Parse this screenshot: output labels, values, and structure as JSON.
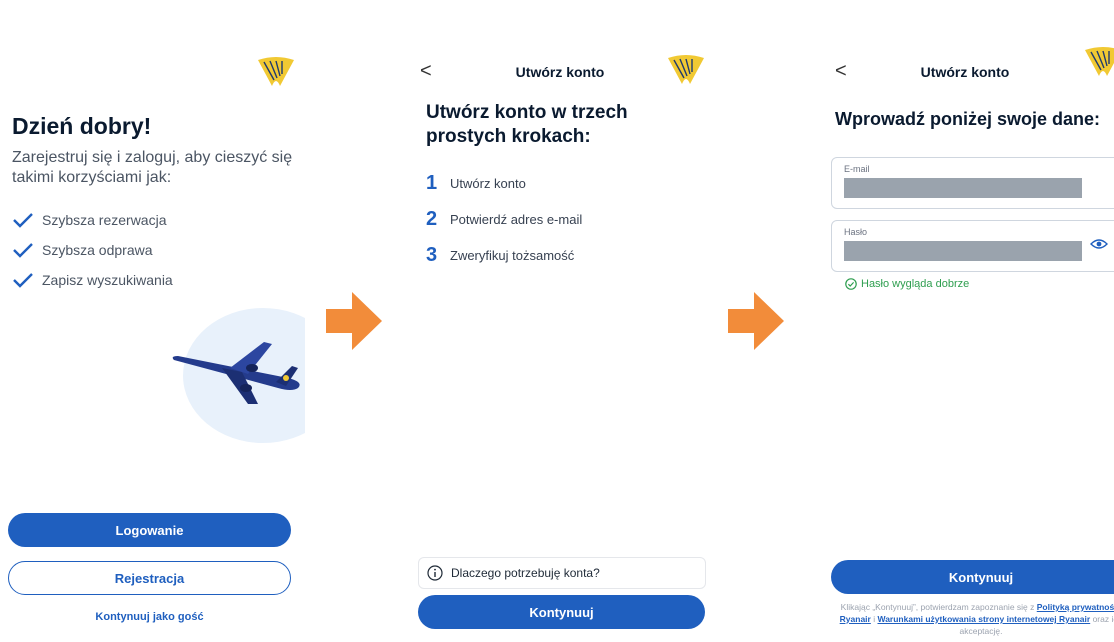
{
  "colors": {
    "primary": "#1f5fbf",
    "arrow": "#f28c3a",
    "logo": "#f1c933",
    "success": "#2e9e4f"
  },
  "screen1": {
    "greeting": "Dzień dobry!",
    "subtitle": "Zarejestruj się i zaloguj, aby cieszyć się takimi korzyściami jak:",
    "benefits": [
      "Szybsza rezerwacja",
      "Szybsza odprawa",
      "Zapisz wyszukiwania"
    ],
    "login_label": "Logowanie",
    "register_label": "Rejestracja",
    "guest_label": "Kontynuuj jako gość"
  },
  "screen2": {
    "back_label": "<",
    "title": "Utwórz konto",
    "heading": "Utwórz konto w trzech prostych krokach:",
    "steps": [
      {
        "num": "1",
        "label": "Utwórz konto"
      },
      {
        "num": "2",
        "label": "Potwierdź adres e-mail"
      },
      {
        "num": "3",
        "label": "Zweryfikuj tożsamość"
      }
    ],
    "why_label": "Dlaczego potrzebuję konta?",
    "continue_label": "Kontynuuj"
  },
  "screen3": {
    "back_label": "<",
    "title": "Utwórz konto",
    "heading": "Wprowadź poniżej swoje dane:",
    "email_label": "E-mail",
    "password_label": "Hasło",
    "password_ok": "Hasło wygląda dobrze",
    "continue_label": "Kontynuuj",
    "disclaimer_prefix": "Klikając „Kontynuuj”, potwierdzam zapoznanie się z ",
    "privacy_link": "Polityką prywatności Ryanair",
    "and": " i ",
    "terms_link": "Warunkami użytkowania strony internetowej Ryanair",
    "disclaimer_suffix": " oraz ich akceptację."
  }
}
